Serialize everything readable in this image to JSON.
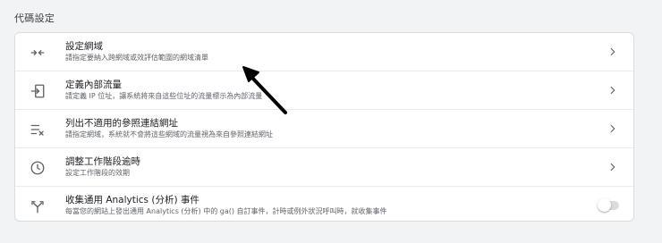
{
  "section": {
    "title": "代碼設定"
  },
  "rows": [
    {
      "icon": "merge-arrows-icon",
      "title": "設定網域",
      "description": "請指定要納入跨網域或效評估範圍的網域清單",
      "control": "chevron"
    },
    {
      "icon": "login-arrow-icon",
      "title": "定義內部流量",
      "description": "請定義 IP 位址，讓系統將來自這些位址的流量標示為內部流量",
      "control": "chevron"
    },
    {
      "icon": "list-exclude-icon",
      "title": "列出不適用的參照連結網址",
      "description": "請指定網域，系統就不會將這些網域的流量視為來自參照連結網址",
      "control": "chevron"
    },
    {
      "icon": "clock-icon",
      "title": "調整工作階段逾時",
      "description": "設定工作階段的效期",
      "control": "chevron"
    },
    {
      "icon": "fork-icon",
      "title": "收集通用 Analytics (分析) 事件",
      "description": "每當您的網站上發出通用 Analytics (分析) 中的 ga() 自訂事件，計時或例外狀況呼叫時，就收集事件",
      "control": "toggle",
      "toggle_on": false
    }
  ],
  "highlight_color": "#fff84a",
  "annotation": "arrow-pointer-icon"
}
